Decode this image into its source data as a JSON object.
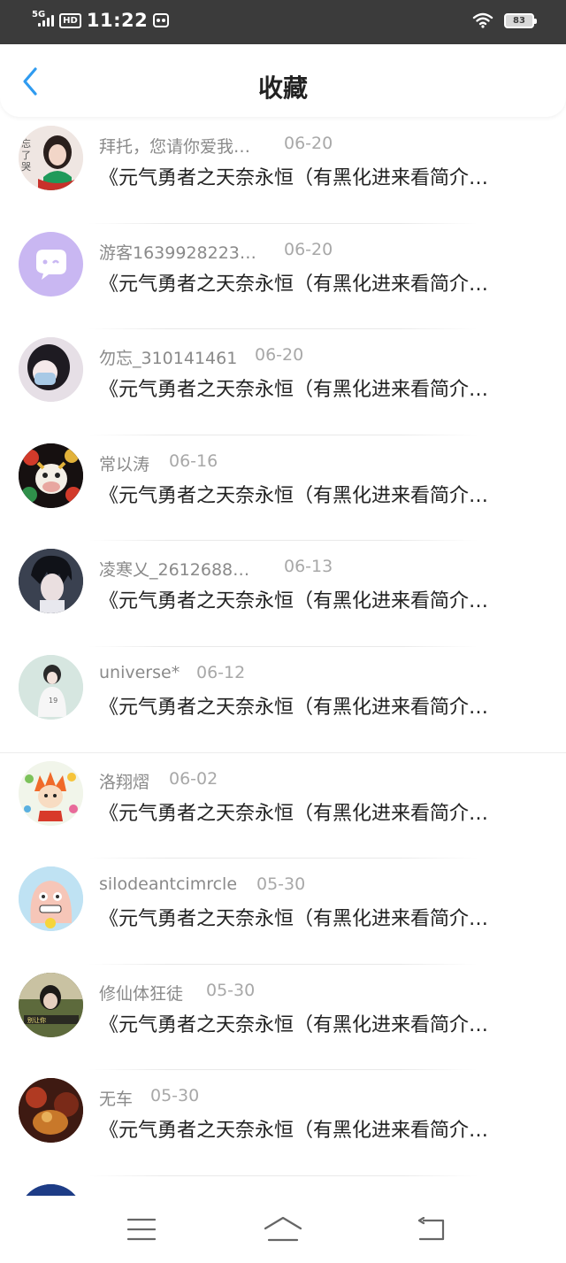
{
  "status_bar": {
    "network": "5G",
    "hd": "HD",
    "time": "11:22",
    "battery": "83"
  },
  "header": {
    "title": "收藏",
    "accent": "#2f9bf0"
  },
  "items": [
    {
      "user": "拜托，您请你爱我…",
      "date": "06-20",
      "title": "《元气勇者之天奈永恒（有黑化进来看简介…"
    },
    {
      "user": "游客1639928223…",
      "date": "06-20",
      "title": "《元气勇者之天奈永恒（有黑化进来看简介…"
    },
    {
      "user": "勿忘_310141461",
      "date": "06-20",
      "title": "《元气勇者之天奈永恒（有黑化进来看简介…"
    },
    {
      "user": "常以涛",
      "date": "06-16",
      "title": "《元气勇者之天奈永恒（有黑化进来看简介…"
    },
    {
      "user": "凌寒乂_2612688…",
      "date": "06-13",
      "title": "《元气勇者之天奈永恒（有黑化进来看简介…"
    },
    {
      "user": "universe*",
      "date": "06-12",
      "title": "《元气勇者之天奈永恒（有黑化进来看简介…"
    },
    {
      "user": "洛翔熠",
      "date": "06-02",
      "title": "《元气勇者之天奈永恒（有黑化进来看简介…"
    },
    {
      "user": "silodeantcimrcle",
      "date": "05-30",
      "title": "《元气勇者之天奈永恒（有黑化进来看简介…"
    },
    {
      "user": "修仙体狂徒",
      "date": "05-30",
      "title": "《元气勇者之天奈永恒（有黑化进来看简介…"
    },
    {
      "user": "无车",
      "date": "05-30",
      "title": "《元气勇者之天奈永恒（有黑化进来看简介…"
    }
  ],
  "avatars": {
    "avatar_1_text": "忘了哭"
  },
  "nav_bar": {
    "icons": [
      "menu-icon",
      "home-icon",
      "back-icon"
    ]
  }
}
